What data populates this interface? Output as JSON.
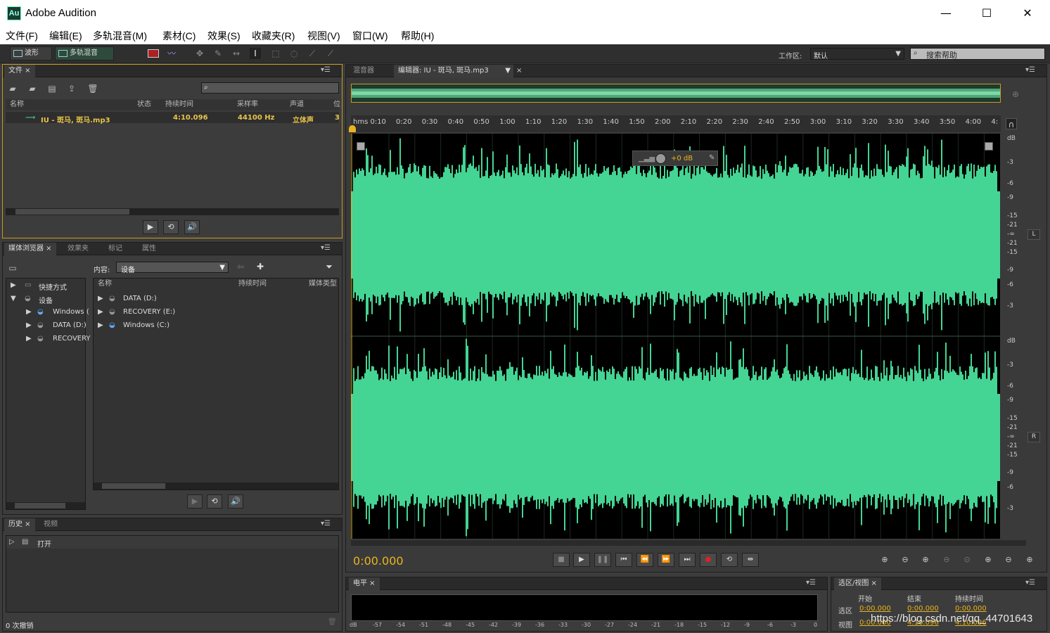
{
  "app": {
    "title": "Adobe Audition",
    "logo": "Au",
    "window_controls": [
      "—",
      "☐",
      "✕"
    ],
    "watermark": "https://blog.csdn.net/qq_44701643"
  },
  "menu": [
    "文件(F)",
    "编辑(E)",
    "多轨混音(M)",
    "素材(C)",
    "效果(S)",
    "收藏夹(R)",
    "视图(V)",
    "窗口(W)",
    "帮助(H)"
  ],
  "toolbar": {
    "waveform_label": "波形",
    "multitrack_label": "多轨混音",
    "workspace_label": "工作区:",
    "workspace_value": "默认",
    "search_help": "搜索帮助"
  },
  "files_panel": {
    "tab": "文件",
    "columns": [
      "名称",
      "状态",
      "持续时间",
      "采样率",
      "声道",
      "位"
    ],
    "file": {
      "name": "IU - 斑马, 斑马.mp3",
      "duration": "4:10.096",
      "rate": "44100 Hz",
      "channels": "立体声",
      "bits": "3"
    }
  },
  "media_panel": {
    "tabs": [
      "媒体浏览器",
      "效果夹",
      "标记",
      "属性"
    ],
    "content_label": "内容:",
    "content_value": "设备",
    "tree": [
      "快捷方式",
      "设备",
      "Windows (",
      "DATA (D:)",
      "RECOVERY"
    ],
    "columns": [
      "名称",
      "持续时间",
      "媒体类型"
    ],
    "drives": [
      "DATA (D:)",
      "RECOVERY (E:)",
      "Windows (C:)"
    ]
  },
  "history_panel": {
    "tabs": [
      "历史",
      "视频"
    ],
    "item": "打开",
    "undo_count": "0 次撤销"
  },
  "editor": {
    "tabs": [
      "混音器",
      "编辑器: IU - 斑马, 斑马.mp3"
    ],
    "ruler": [
      "hms 0:10",
      "0:20",
      "0:30",
      "0:40",
      "0:50",
      "1:00",
      "1:10",
      "1:20",
      "1:30",
      "1:40",
      "1:50",
      "2:00",
      "2:10",
      "2:20",
      "2:30",
      "2:40",
      "2:50",
      "3:00",
      "3:10",
      "3:20",
      "3:30",
      "3:40",
      "3:50",
      "4:00",
      "4:"
    ],
    "gain": "+0 dB",
    "db_scale": [
      "dB",
      "-3",
      "-6",
      "-9",
      "-15",
      "-21",
      "-∞",
      "-21",
      "-15",
      "-9",
      "-6",
      "-3"
    ],
    "channel_left": "L",
    "channel_right": "R",
    "time": "0:00.000",
    "wave_color": "#44d493"
  },
  "level_panel": {
    "tab": "电平",
    "scale": [
      "dB",
      "-57",
      "-54",
      "-51",
      "-48",
      "-45",
      "-42",
      "-39",
      "-36",
      "-33",
      "-30",
      "-27",
      "-24",
      "-21",
      "-18",
      "-15",
      "-12",
      "-9",
      "-6",
      "-3",
      "0"
    ]
  },
  "selection_panel": {
    "tab": "选区/视图",
    "cols": [
      "开始",
      "结束",
      "持续时间"
    ],
    "rows": [
      {
        "label": "选区",
        "values": [
          "0:00.000",
          "0:00.000",
          "0:00.000"
        ]
      },
      {
        "label": "视图",
        "values": [
          "0:00.000",
          "4:10.096",
          "4:10.096"
        ]
      }
    ]
  }
}
